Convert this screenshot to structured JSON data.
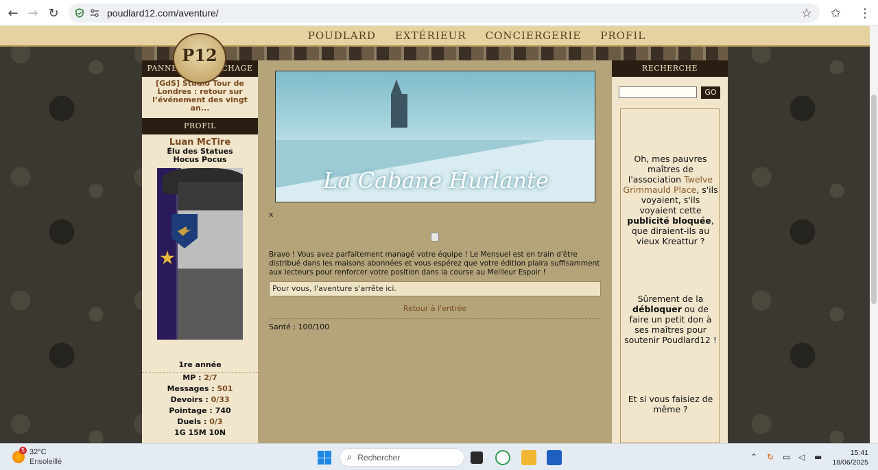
{
  "browser": {
    "url": "poudlard12.com/aventure/"
  },
  "menu": {
    "items": [
      "Poudlard",
      "Extérieur",
      "Conciergerie",
      "Profil"
    ]
  },
  "logo": {
    "text": "P12"
  },
  "left": {
    "panel_head": "Panneau d'affichage",
    "news": "[GdS] Studio Tour de Londres : retour sur l’événement des vingt an...",
    "profile_head": "Profil",
    "name": "Luan McTire",
    "title1": "Élu des Statues",
    "title2": "Hocus Pocus",
    "year": "1re année",
    "stats": [
      {
        "label": "MP :",
        "value": "2/7"
      },
      {
        "label": "Messages :",
        "value": "501"
      },
      {
        "label": "Devoirs :",
        "value": "0/33"
      },
      {
        "label": "Pointage :",
        "value": "740"
      },
      {
        "label": "Duels :",
        "value": "0/3"
      }
    ],
    "money": "1G 15M 10N"
  },
  "main": {
    "hero_title": "La Cabane Hurlante",
    "x_mark": "x",
    "story": "Bravo ! Vous avez parfaitement managé votre équipe ! Le Mensuel est en train d'être distribué dans les maisons abonnées et vous espérez que votre édition plaira suffisamment aux lecteurs pour renforcer votre position dans la course au Meilleur Espoir !",
    "end_message": "Pour vous, l'aventure s'arrête ici.",
    "back_link": "Retour à l'entrée",
    "health": "Santé : 100/100"
  },
  "right": {
    "search_head": "Recherche",
    "go_label": "GO",
    "ad": {
      "p1_a": "Oh, mes pauvres maîtres de l'association",
      "p1_link": "Twelve Grimmauld Place",
      "p1_b": ", s'ils voyaient, s'ils voyaient cette",
      "p1_strong": "publicité bloquée",
      "p1_c": ", que diraient-ils au vieux Kreattur ?",
      "p2_a": "Sûrement de la",
      "p2_strong": "débloquer",
      "p2_b": "ou de faire un petit don à ses maîtres pour soutenir Poudlard12 !",
      "p3": "Et si vous faisiez de même ?"
    }
  },
  "taskbar": {
    "weather_badge": "5",
    "temp": "32°C",
    "weather_desc": "Ensoleillé",
    "search_placeholder": "Rechercher",
    "time": "15:41",
    "date": "18/06/2025"
  }
}
